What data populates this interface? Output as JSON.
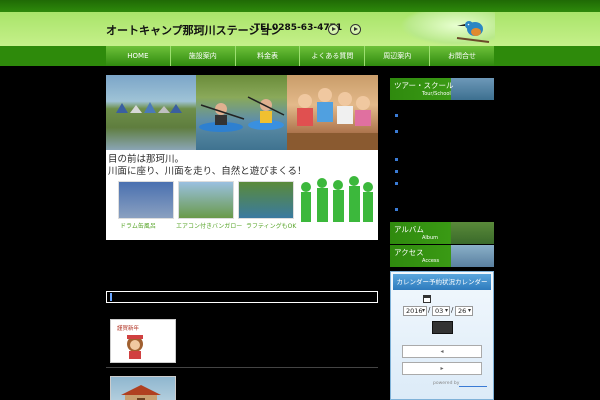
{
  "header": {
    "site_title": "オートキャンプ那珂川ステーション",
    "tel": "TEL0285-63-4771"
  },
  "nav": {
    "items": [
      "HOME",
      "施設案内",
      "料金表",
      "よくある質問",
      "周辺案内",
      "お問合せ"
    ]
  },
  "banner": {
    "line1": "目の前は那珂川。",
    "line2": "川面に座り、川面を走り、自然と遊びまくる！",
    "thumb_labels": [
      "ドラム缶風呂",
      "エアコン付きバンガロー",
      "ラフティングもOK"
    ]
  },
  "posts": {
    "new_year_text": "謹賀新年"
  },
  "sidebar": {
    "tour": {
      "title": "ツアー・スクール",
      "sub": "Tour/School"
    },
    "album": {
      "title": "アルバム",
      "sub": "Album"
    },
    "access": {
      "title": "アクセス",
      "sub": "Access"
    },
    "calendar": {
      "title": "カレンダー予約状況カレンダー",
      "year": "2016",
      "month": "03",
      "day": "26",
      "prev_symbol": "◂",
      "next_symbol": "▸",
      "powered": "powered by"
    }
  },
  "colors": {
    "header_green": "#b9ec7c",
    "nav_green": "#2f8a0e",
    "calendar_blue": "#2e7bbd"
  }
}
